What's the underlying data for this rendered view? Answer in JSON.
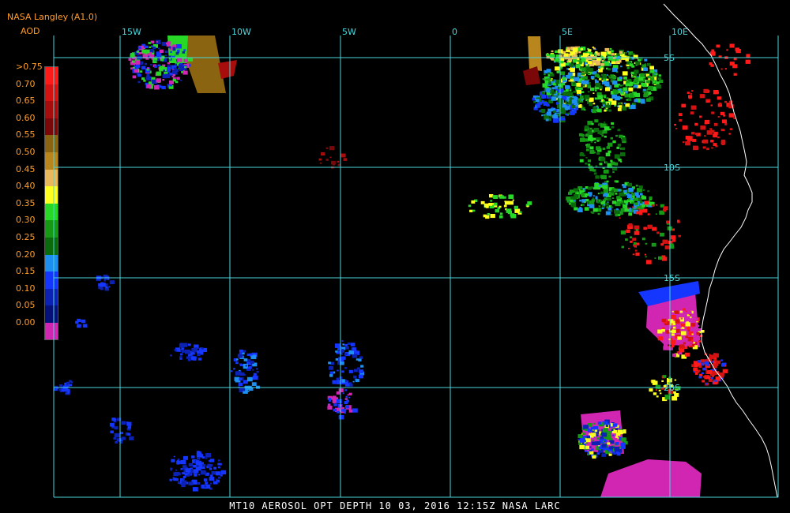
{
  "header": {
    "source": "NASA Langley (A1.0)",
    "variable": "AOD"
  },
  "legend": {
    "entries": [
      {
        "label": ">0.75",
        "color": "#ff1a1a"
      },
      {
        "label": "0.70",
        "color": "#d51212"
      },
      {
        "label": "0.65",
        "color": "#a70d0d"
      },
      {
        "label": "0.60",
        "color": "#7a0808"
      },
      {
        "label": "0.55",
        "color": "#8a6410"
      },
      {
        "label": "0.50",
        "color": "#b8861c"
      },
      {
        "label": "0.45",
        "color": "#e9b85a"
      },
      {
        "label": "0.40",
        "color": "#ffff1f"
      },
      {
        "label": "0.35",
        "color": "#27d827"
      },
      {
        "label": "0.30",
        "color": "#169a16"
      },
      {
        "label": "0.25",
        "color": "#0b6a0b"
      },
      {
        "label": "0.20",
        "color": "#1d8ff0"
      },
      {
        "label": "0.15",
        "color": "#1436ff"
      },
      {
        "label": "0.10",
        "color": "#0c22b4"
      },
      {
        "label": "0.05",
        "color": "#06107a"
      },
      {
        "label": "0.00",
        "color": "#d126b2"
      }
    ]
  },
  "grid": {
    "color": "#4ad6dc",
    "longitudes": [
      "15W",
      "10W",
      "5W",
      "0",
      "5E",
      "10E"
    ],
    "latitudes": [
      "5S",
      "10S",
      "15S",
      "20S"
    ]
  },
  "footer": {
    "text": "MT10  AEROSOL OPT DEPTH   10 03, 2016 12:15Z  NASA LARC"
  },
  "colors": {
    "background": "#000000",
    "label": "#ff9d2c",
    "coastline": "#ffffff"
  }
}
